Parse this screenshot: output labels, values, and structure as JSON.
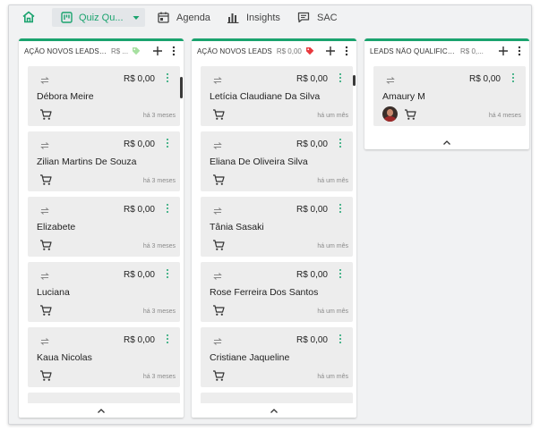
{
  "nav": {
    "home_icon": "home-icon",
    "tabs": [
      {
        "label": "Quiz Qu...",
        "icon": "kanban-board-icon",
        "active": true
      },
      {
        "label": "Agenda",
        "icon": "calendar-icon"
      },
      {
        "label": "Insights",
        "icon": "bar-chart-icon"
      },
      {
        "label": "SAC",
        "icon": "chat-icon"
      }
    ]
  },
  "colors": {
    "accent": "#1aa36e",
    "tag_green": "#a6e0a0",
    "tag_red": "#e8383d"
  },
  "columns": [
    {
      "title": "AÇÃO NOVOS LEADS - ...",
      "value": "R$ ...",
      "tag_color": "green",
      "cards": [
        {
          "price": "R$ 0,00",
          "name": "Débora Meire",
          "date": "há 3 meses"
        },
        {
          "price": "R$ 0,00",
          "name": "Zilian Martins De Souza",
          "date": "há 3 meses"
        },
        {
          "price": "R$ 0,00",
          "name": "Elizabete",
          "date": "há 3 meses"
        },
        {
          "price": "R$ 0,00",
          "name": "Luciana",
          "date": "há 3 meses"
        },
        {
          "price": "R$ 0,00",
          "name": "Kaua Nicolas",
          "date": "há 3 meses"
        }
      ]
    },
    {
      "title": "AÇÃO NOVOS LEADS",
      "value": "R$ 0,00",
      "tag_color": "red",
      "cards": [
        {
          "price": "R$ 0,00",
          "name": "Letícia Claudiane Da Silva",
          "date": "há um mês"
        },
        {
          "price": "R$ 0,00",
          "name": "Eliana De Oliveira Silva",
          "date": "há um mês"
        },
        {
          "price": "R$ 0,00",
          "name": "Tânia Sasaki",
          "date": "há um mês"
        },
        {
          "price": "R$ 0,00",
          "name": "Rose Ferreira Dos Santos",
          "date": "há um mês"
        },
        {
          "price": "R$ 0,00",
          "name": "Cristiane Jaqueline",
          "date": "há um mês"
        }
      ]
    },
    {
      "title": "LEADS NÃO QUALIFICAD...",
      "value": "R$ 0,...",
      "tag_color": "none",
      "cards": [
        {
          "price": "R$ 0,00",
          "name": "Amaury M",
          "date": "há 4 meses",
          "has_avatar": true
        }
      ]
    }
  ]
}
